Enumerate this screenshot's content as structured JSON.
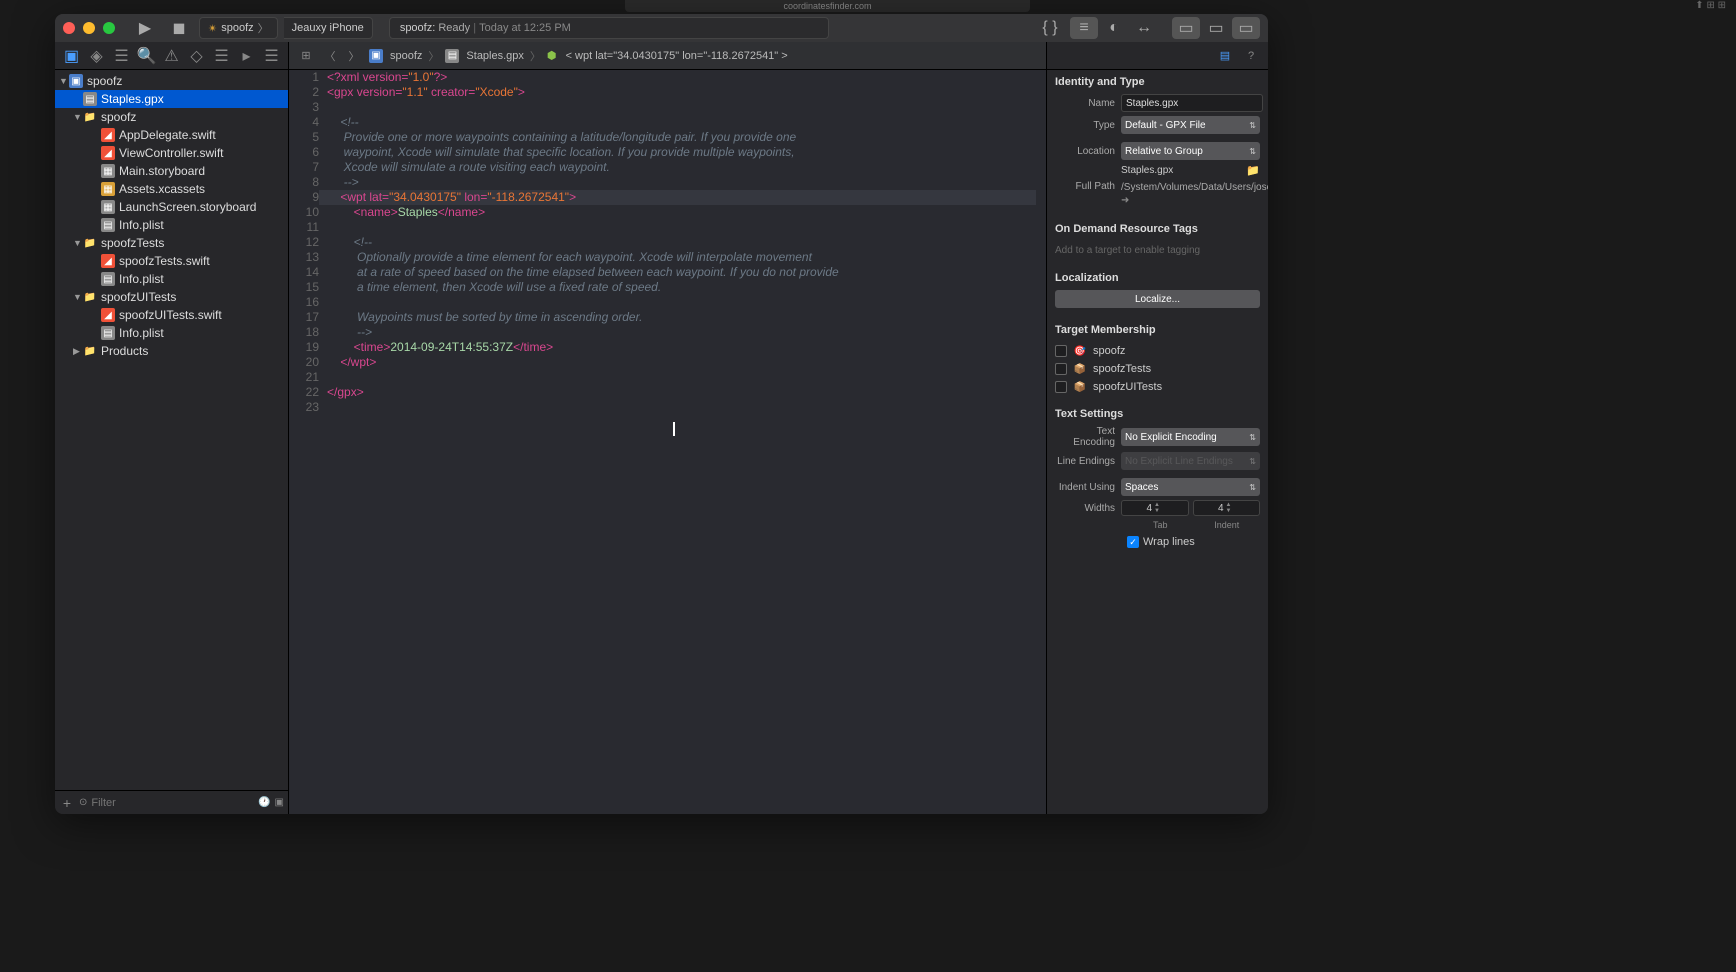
{
  "browser_tab_url": "coordinatesfinder.com",
  "toolbar": {
    "scheme_name": "spoofz",
    "destination": "Jeauxy iPhone",
    "status_prefix": "spoofz:",
    "status_ready": "Ready",
    "status_time": "Today at 12:25 PM"
  },
  "navigator": {
    "filter_placeholder": "Filter",
    "tree": [
      {
        "level": 0,
        "disclosure": "▼",
        "icon": "proj",
        "label": "spoofz"
      },
      {
        "level": 1,
        "disclosure": "",
        "icon": "gpx",
        "label": "Staples.gpx",
        "selected": true
      },
      {
        "level": 1,
        "disclosure": "▼",
        "icon": "folder-yellow",
        "label": "spoofz"
      },
      {
        "level": 2,
        "disclosure": "",
        "icon": "swift",
        "label": "AppDelegate.swift"
      },
      {
        "level": 2,
        "disclosure": "",
        "icon": "swift",
        "label": "ViewController.swift"
      },
      {
        "level": 2,
        "disclosure": "",
        "icon": "sb",
        "label": "Main.storyboard"
      },
      {
        "level": 2,
        "disclosure": "",
        "icon": "xc",
        "label": "Assets.xcassets"
      },
      {
        "level": 2,
        "disclosure": "",
        "icon": "sb",
        "label": "LaunchScreen.storyboard"
      },
      {
        "level": 2,
        "disclosure": "",
        "icon": "plist",
        "label": "Info.plist"
      },
      {
        "level": 1,
        "disclosure": "▼",
        "icon": "folder-yellow",
        "label": "spoofzTests"
      },
      {
        "level": 2,
        "disclosure": "",
        "icon": "swift",
        "label": "spoofzTests.swift"
      },
      {
        "level": 2,
        "disclosure": "",
        "icon": "plist",
        "label": "Info.plist"
      },
      {
        "level": 1,
        "disclosure": "▼",
        "icon": "folder-yellow",
        "label": "spoofzUITests"
      },
      {
        "level": 2,
        "disclosure": "",
        "icon": "swift",
        "label": "spoofzUITests.swift"
      },
      {
        "level": 2,
        "disclosure": "",
        "icon": "plist",
        "label": "Info.plist"
      },
      {
        "level": 1,
        "disclosure": "▶",
        "icon": "folder-yellow",
        "label": "Products"
      }
    ]
  },
  "jumpbar": {
    "seg1": "spoofz",
    "seg2": "Staples.gpx",
    "seg3": "wpt lat=\"34.0430175\" lon=\"-118.2672541\""
  },
  "code": {
    "lines": [
      {
        "n": 1,
        "html": "<span class='t-pi'>&lt;?xml version=</span><span class='t-str'>\"1.0\"</span><span class='t-pi'>?&gt;</span>"
      },
      {
        "n": 2,
        "html": "<span class='t-tag'>&lt;gpx</span> <span class='t-attr'>version=</span><span class='t-str'>\"1.1\"</span> <span class='t-attr'>creator=</span><span class='t-str'>\"Xcode\"</span><span class='t-tag'>&gt;</span>"
      },
      {
        "n": 3,
        "html": ""
      },
      {
        "n": 4,
        "html": "    <span class='t-comm'>&lt;!--</span>"
      },
      {
        "n": 5,
        "html": "     <span class='t-comm'>Provide one or more waypoints containing a latitude/longitude pair. If you provide one</span>"
      },
      {
        "n": 6,
        "html": "     <span class='t-comm'>waypoint, Xcode will simulate that specific location. If you provide multiple waypoints,</span>"
      },
      {
        "n": 7,
        "html": "     <span class='t-comm'>Xcode will simulate a route visiting each waypoint.</span>"
      },
      {
        "n": 8,
        "html": "     <span class='t-comm'>--&gt;</span>"
      },
      {
        "n": 9,
        "hl": true,
        "html": "    <span class='t-tag'>&lt;wpt</span> <span class='t-attr'>lat=</span><span class='t-str'>\"34.0430175\"</span> <span class='t-attr'>lon=</span><span class='t-str'>\"-118.2672541\"</span><span class='t-tag'>&gt;</span>"
      },
      {
        "n": 10,
        "html": "        <span class='t-tag'>&lt;name&gt;</span><span class='t-text'>Staples</span><span class='t-tag'>&lt;/name&gt;</span>"
      },
      {
        "n": 11,
        "html": ""
      },
      {
        "n": 12,
        "html": "        <span class='t-comm'>&lt;!--</span>"
      },
      {
        "n": 13,
        "html": "         <span class='t-comm'>Optionally provide a time element for each waypoint. Xcode will interpolate movement</span>"
      },
      {
        "n": 14,
        "html": "         <span class='t-comm'>at a rate of speed based on the time elapsed between each waypoint. If you do not provide</span>"
      },
      {
        "n": 15,
        "html": "         <span class='t-comm'>a time element, then Xcode will use a fixed rate of speed.</span>"
      },
      {
        "n": 16,
        "html": ""
      },
      {
        "n": 17,
        "html": "         <span class='t-comm'>Waypoints must be sorted by time in ascending order.</span>"
      },
      {
        "n": 18,
        "html": "         <span class='t-comm'>--&gt;</span>"
      },
      {
        "n": 19,
        "html": "        <span class='t-tag'>&lt;time&gt;</span><span class='t-text'>2014-09-24T14:55:37Z</span><span class='t-tag'>&lt;/time&gt;</span>"
      },
      {
        "n": 20,
        "html": "    <span class='t-tag'>&lt;/wpt&gt;</span>"
      },
      {
        "n": 21,
        "html": ""
      },
      {
        "n": 22,
        "html": "<span class='t-tag'>&lt;/gpx&gt;</span>"
      },
      {
        "n": 23,
        "html": ""
      }
    ]
  },
  "inspector": {
    "identity_title": "Identity and Type",
    "name_label": "Name",
    "name_value": "Staples.gpx",
    "type_label": "Type",
    "type_value": "Default - GPX File",
    "location_label": "Location",
    "location_value": "Relative to Group",
    "location_file": "Staples.gpx",
    "fullpath_label": "Full Path",
    "fullpath_value": "/System/Volumes/Data/Users/joseph.callaway/Desktop/spoofz/Staples.gpx",
    "ondemand_title": "On Demand Resource Tags",
    "ondemand_placeholder": "Add to a target to enable tagging",
    "localization_title": "Localization",
    "localize_button": "Localize...",
    "target_title": "Target Membership",
    "targets": [
      {
        "name": "spoofz",
        "icon": "🎯"
      },
      {
        "name": "spoofzTests",
        "icon": "📦"
      },
      {
        "name": "spoofzUITests",
        "icon": "📦"
      }
    ],
    "text_title": "Text Settings",
    "encoding_label": "Text Encoding",
    "encoding_value": "No Explicit Encoding",
    "lineendings_label": "Line Endings",
    "lineendings_value": "No Explicit Line Endings",
    "indent_label": "Indent Using",
    "indent_value": "Spaces",
    "widths_label": "Widths",
    "tab_width": "4",
    "indent_width": "4",
    "tab_sublabel": "Tab",
    "indent_sublabel": "Indent",
    "wrap_label": "Wrap lines"
  }
}
